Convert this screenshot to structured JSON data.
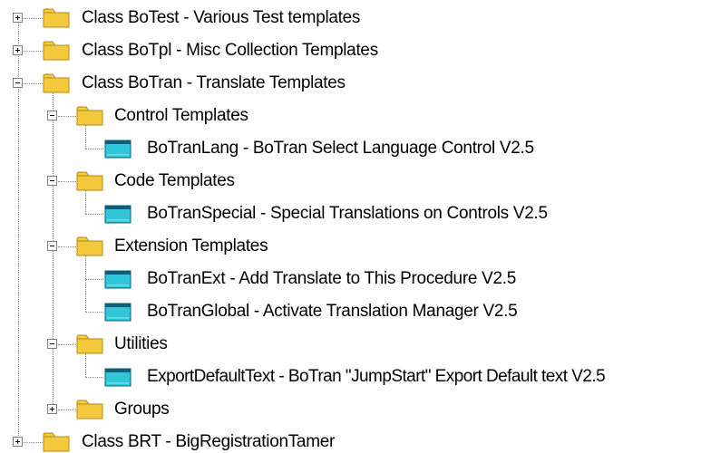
{
  "tree": {
    "nodes": [
      {
        "label": "Class BoTest - Various Test templates",
        "type": "folder",
        "state": "collapsed"
      },
      {
        "label": "Class BoTpl - Misc Collection Templates",
        "type": "folder",
        "state": "collapsed"
      },
      {
        "label": "Class BoTran -  Translate Templates",
        "type": "folder",
        "state": "expanded"
      },
      {
        "label": "Control Templates",
        "type": "folder",
        "state": "expanded"
      },
      {
        "label": "BoTranLang - BoTran Select Language Control V2.5",
        "type": "template"
      },
      {
        "label": "Code Templates",
        "type": "folder",
        "state": "expanded"
      },
      {
        "label": "BoTranSpecial - Special Translations on Controls V2.5",
        "type": "template"
      },
      {
        "label": "Extension Templates",
        "type": "folder",
        "state": "expanded"
      },
      {
        "label": "BoTranExt - Add Translate to This Procedure V2.5",
        "type": "template"
      },
      {
        "label": "BoTranGlobal - Activate Translation Manager V2.5",
        "type": "template"
      },
      {
        "label": "Utilities",
        "type": "folder",
        "state": "expanded"
      },
      {
        "label": "ExportDefaultText - BoTran \"JumpStart\" Export Default text V2.5",
        "type": "template"
      },
      {
        "label": "Groups",
        "type": "folder",
        "state": "collapsed"
      },
      {
        "label": "Class BRT - BigRegistrationTamer",
        "type": "folder",
        "state": "collapsed"
      }
    ]
  },
  "colors": {
    "folder_fill": "#f5c93e",
    "folder_edge": "#b78a10",
    "template_fill": "#30c8d8",
    "template_edge": "#0a5f7a",
    "tree_line": "#8a8a8a"
  },
  "icons": {
    "folder": "folder-icon",
    "template": "template-icon",
    "expand": "plus-box-icon",
    "collapse": "minus-box-icon"
  }
}
